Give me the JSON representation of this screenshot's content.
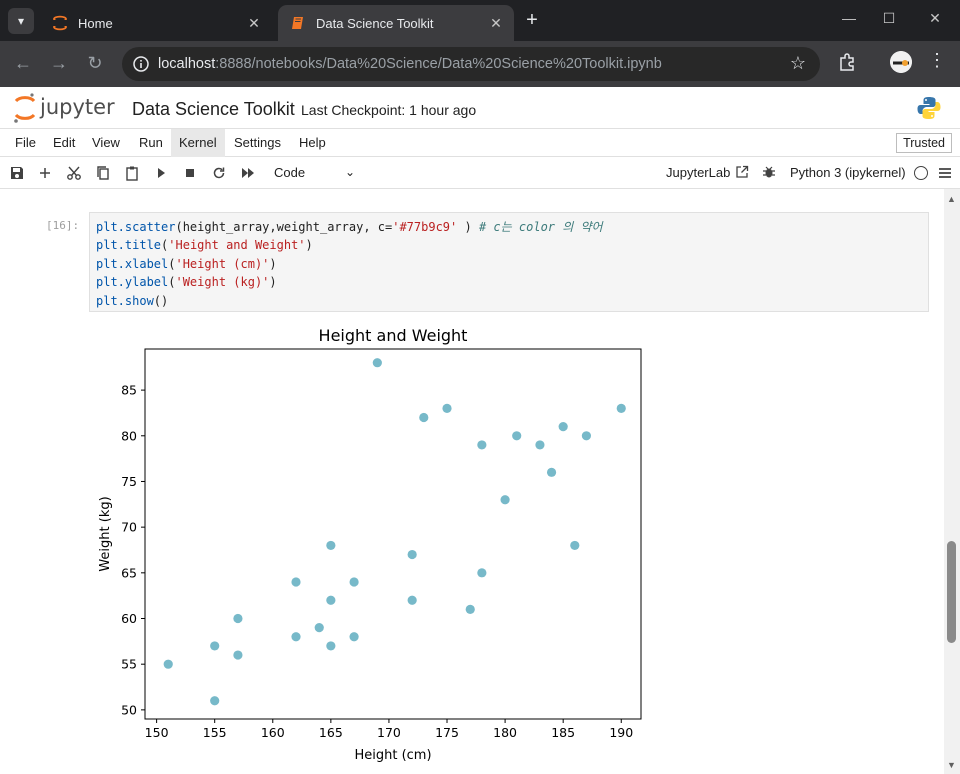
{
  "browser": {
    "tabs": [
      {
        "label": "Home",
        "active": false
      },
      {
        "label": "Data Science Toolkit",
        "active": true
      }
    ],
    "url_host": "localhost",
    "url_rest": ":8888/notebooks/Data%20Science/Data%20Science%20Toolkit.ipynb"
  },
  "jupyter": {
    "logo_text": "jupyter",
    "notebook_title": "Data Science Toolkit",
    "checkpoint": "Last Checkpoint: 1 hour ago",
    "menu": [
      "File",
      "Edit",
      "View",
      "Run",
      "Kernel",
      "Settings",
      "Help"
    ],
    "highlighted_menu": "Kernel",
    "trusted": "Trusted",
    "cell_type": "Code",
    "jupyterlab_label": "JupyterLab",
    "kernel_name": "Python 3 (ipykernel)"
  },
  "cell": {
    "prompt": "[16]:",
    "lines": [
      {
        "fn": "plt.scatter",
        "args": "(height_array,weight_array, c=",
        "str": "'#77b9c9'",
        "tail": " ) ",
        "comment": "# c는 color 의 약어"
      },
      {
        "fn": "plt.title",
        "args": "(",
        "str": "'Height and Weight'",
        "tail": ")",
        "comment": ""
      },
      {
        "fn": "plt.xlabel",
        "args": "(",
        "str": "'Height (cm)'",
        "tail": ")",
        "comment": ""
      },
      {
        "fn": "plt.ylabel",
        "args": "(",
        "str": "'Weight (kg)'",
        "tail": ")",
        "comment": ""
      },
      {
        "fn": "plt.show",
        "args": "()",
        "str": "",
        "tail": "",
        "comment": ""
      }
    ]
  },
  "chart_data": {
    "type": "scatter",
    "title": "Height and Weight",
    "xlabel": "Height (cm)",
    "ylabel": "Weight (kg)",
    "xlim": [
      149,
      191.7
    ],
    "ylim": [
      49,
      89.5
    ],
    "xticks": [
      150,
      155,
      160,
      165,
      170,
      175,
      180,
      185,
      190
    ],
    "yticks": [
      50,
      55,
      60,
      65,
      70,
      75,
      80,
      85
    ],
    "color": "#77b9c9",
    "points": [
      [
        151,
        55
      ],
      [
        155,
        51
      ],
      [
        155,
        57
      ],
      [
        157,
        56
      ],
      [
        157,
        60
      ],
      [
        162,
        58
      ],
      [
        162,
        64
      ],
      [
        164,
        59
      ],
      [
        165,
        57
      ],
      [
        165,
        62
      ],
      [
        165,
        68
      ],
      [
        167,
        58
      ],
      [
        167,
        64
      ],
      [
        169,
        88
      ],
      [
        172,
        62
      ],
      [
        172,
        67
      ],
      [
        173,
        82
      ],
      [
        175,
        83
      ],
      [
        177,
        61
      ],
      [
        178,
        65
      ],
      [
        178,
        79
      ],
      [
        180,
        73
      ],
      [
        181,
        80
      ],
      [
        183,
        79
      ],
      [
        184,
        76
      ],
      [
        185,
        81
      ],
      [
        186,
        68
      ],
      [
        187,
        80
      ],
      [
        190,
        83
      ]
    ]
  }
}
